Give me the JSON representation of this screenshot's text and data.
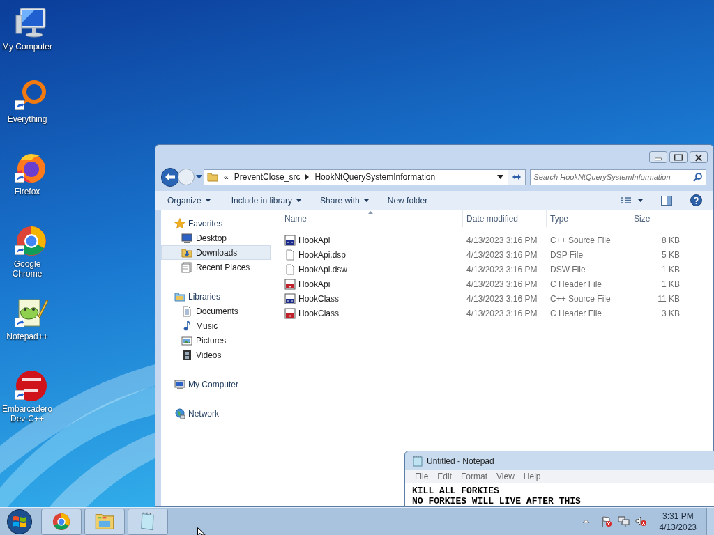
{
  "desktop_icons": [
    {
      "label": "My Computer",
      "kind": "computer",
      "shortcut": false
    },
    {
      "label": "Everything",
      "kind": "everything",
      "shortcut": true
    },
    {
      "label": "Firefox",
      "kind": "firefox",
      "shortcut": true
    },
    {
      "label": "Google Chrome",
      "kind": "chrome",
      "shortcut": true
    },
    {
      "label": "Notepad++",
      "kind": "notepadpp",
      "shortcut": true
    },
    {
      "label": "Embarcadero Dev-C++",
      "kind": "devcpp",
      "shortcut": true
    }
  ],
  "explorer": {
    "address": {
      "overflow": "«",
      "crumbs": [
        "PreventClose_src",
        "HookNtQuerySystemInformation"
      ]
    },
    "search": {
      "placeholder": "Search HookNtQuerySystemInformation"
    },
    "toolbar": [
      {
        "label": "Organize",
        "dropdown": true
      },
      {
        "label": "Include in library",
        "dropdown": true
      },
      {
        "label": "Share with",
        "dropdown": true
      },
      {
        "label": "New folder",
        "dropdown": false
      }
    ],
    "nav": [
      {
        "label": "Favorites",
        "kind": "star",
        "children": [
          {
            "label": "Desktop",
            "kind": "desktop",
            "selected": false
          },
          {
            "label": "Downloads",
            "kind": "downloads",
            "selected": true
          },
          {
            "label": "Recent Places",
            "kind": "recent",
            "selected": false
          }
        ]
      },
      {
        "label": "Libraries",
        "kind": "libraries",
        "children": [
          {
            "label": "Documents",
            "kind": "documents",
            "selected": false
          },
          {
            "label": "Music",
            "kind": "music",
            "selected": false
          },
          {
            "label": "Pictures",
            "kind": "pictures",
            "selected": false
          },
          {
            "label": "Videos",
            "kind": "videos",
            "selected": false
          }
        ]
      },
      {
        "label": "My Computer",
        "kind": "computer"
      },
      {
        "label": "Network",
        "kind": "network"
      }
    ],
    "columns": [
      "Name",
      "Date modified",
      "Type",
      "Size"
    ],
    "files": [
      {
        "name": "HookApi",
        "date": "4/13/2023 3:16 PM",
        "type": "C++ Source File",
        "size": "8 KB",
        "kind": "cpp"
      },
      {
        "name": "HookApi.dsp",
        "date": "4/13/2023 3:16 PM",
        "type": "DSP File",
        "size": "5 KB",
        "kind": "blank"
      },
      {
        "name": "HookApi.dsw",
        "date": "4/13/2023 3:16 PM",
        "type": "DSW File",
        "size": "1 KB",
        "kind": "blank"
      },
      {
        "name": "HookApi",
        "date": "4/13/2023 3:16 PM",
        "type": "C Header File",
        "size": "1 KB",
        "kind": "header"
      },
      {
        "name": "HookClass",
        "date": "4/13/2023 3:16 PM",
        "type": "C++ Source File",
        "size": "11 KB",
        "kind": "cpp"
      },
      {
        "name": "HookClass",
        "date": "4/13/2023 3:16 PM",
        "type": "C Header File",
        "size": "3 KB",
        "kind": "header"
      }
    ]
  },
  "notepad": {
    "title": "Untitled - Notepad",
    "menu": [
      "File",
      "Edit",
      "Format",
      "View",
      "Help"
    ],
    "lines": [
      "KILL ALL FORKIES",
      "NO FORKIES WILL LIVE AFTER THIS"
    ]
  },
  "taskbar": {
    "apps": [
      {
        "kind": "chrome"
      },
      {
        "kind": "explorer"
      },
      {
        "kind": "notepad"
      }
    ],
    "tray": [
      {
        "kind": "flag"
      },
      {
        "kind": "network"
      },
      {
        "kind": "volume"
      }
    ],
    "clock": {
      "time": "3:31 PM",
      "date": "4/13/2023"
    }
  }
}
